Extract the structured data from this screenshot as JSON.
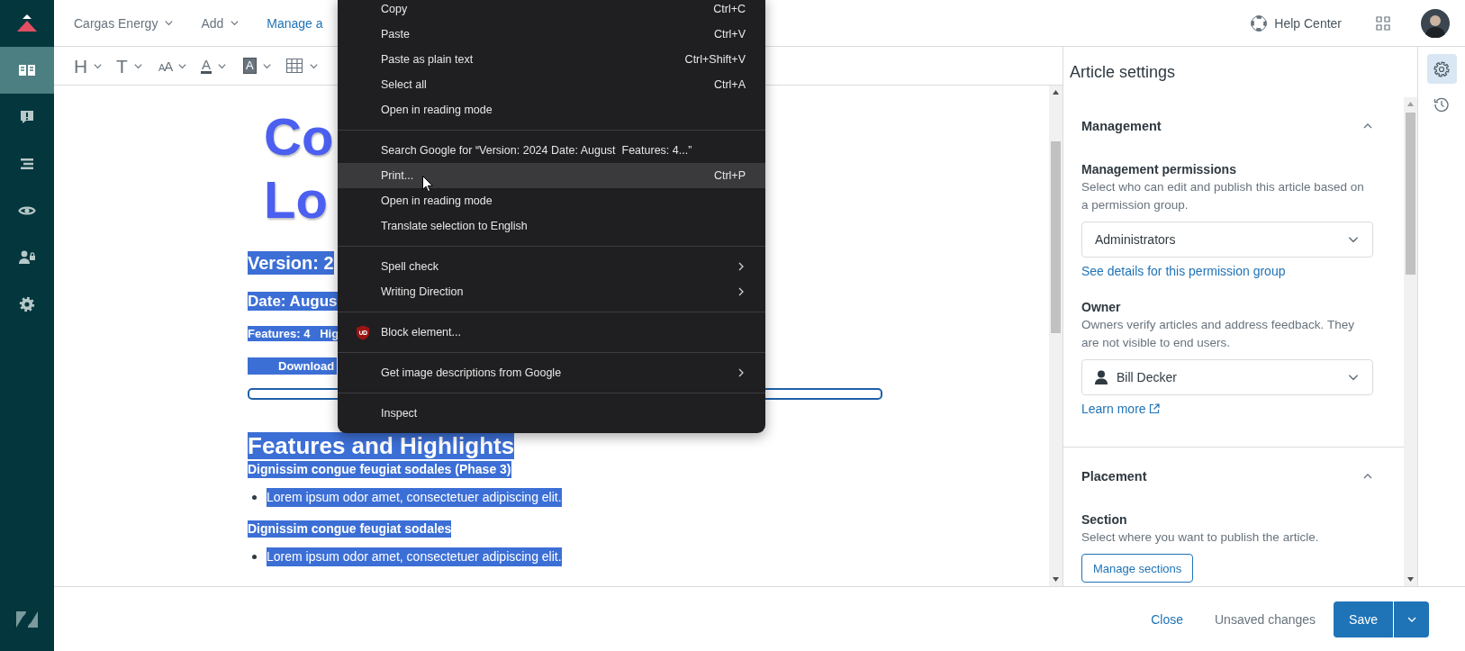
{
  "sidebar": {
    "items": [
      {
        "selected": true
      },
      {
        "selected": false
      },
      {
        "selected": false
      },
      {
        "selected": false
      },
      {
        "selected": false
      },
      {
        "selected": false
      }
    ]
  },
  "topbar": {
    "items": [
      {
        "kind": "menu",
        "label": "Cargas Energy"
      },
      {
        "kind": "menu",
        "label": "Add"
      },
      {
        "kind": "link",
        "label": "Manage a"
      }
    ],
    "help": {
      "label": "Help Center"
    }
  },
  "toolbar": {
    "tools": [
      {
        "kind": "glyph",
        "glyph": "H"
      },
      {
        "kind": "glyph",
        "glyph": "T"
      },
      {
        "kind": "size",
        "glyph": "AA"
      },
      {
        "kind": "color",
        "glyph": "A"
      },
      {
        "kind": "highlight",
        "glyph": "A"
      },
      {
        "kind": "table"
      }
    ]
  },
  "editor": {
    "title_lines": [
      "Co",
      "Lo"
    ],
    "blocks": [
      {
        "kind": "h2",
        "text": "Version: 2",
        "selected": true
      },
      {
        "kind": "h3",
        "text": "Date: Augus",
        "selected": true
      },
      {
        "kind": "meta",
        "text": "Features: 4   Hig",
        "selected": true
      },
      {
        "kind": "button",
        "text": "Download",
        "selected": true
      },
      {
        "kind": "rule"
      },
      {
        "kind": "h1",
        "text": "Features and Highlights",
        "selected": true
      },
      {
        "kind": "h4",
        "text": "Dignissim congue feugiat sodales (Phase 3)",
        "selected": true
      },
      {
        "kind": "bullet",
        "text": "Lorem ipsum odor amet, consectetuer adipiscing elit.",
        "selected": true
      },
      {
        "kind": "h4",
        "text": "Dignissim congue feugiat sodales",
        "selected": true
      },
      {
        "kind": "bullet",
        "text": "Lorem ipsum odor amet, consectetuer adipiscing elit.",
        "selected": true
      }
    ]
  },
  "settings": {
    "title": "Article settings",
    "sections": [
      {
        "title": "Management",
        "expanded": true,
        "fields": [
          {
            "kind": "select",
            "label": "Management permissions",
            "description": "Select who can edit and publish this article based on a permission group.",
            "value": "Administrators",
            "link": "See details for this permission group",
            "external": false
          },
          {
            "kind": "person-select",
            "label": "Owner",
            "description": "Owners verify articles and address feedback. They are not visible to end users.",
            "value": "Bill Decker",
            "link": "Learn more",
            "external": true
          }
        ]
      },
      {
        "title": "Placement",
        "expanded": true,
        "fields": [
          {
            "kind": "button",
            "label": "Section",
            "description": "Select where you want to publish the article.",
            "button": "Manage sections"
          }
        ]
      }
    ]
  },
  "side_tabs": [
    {
      "selected": true
    },
    {
      "selected": false
    }
  ],
  "footer": {
    "close": "Close",
    "status": "Unsaved changes",
    "save": "Save"
  },
  "context_menu": {
    "items": [
      {
        "kind": "item",
        "label": "Copy",
        "shortcut": "Ctrl+C",
        "submenu": false,
        "selected": false
      },
      {
        "kind": "item",
        "label": "Paste",
        "shortcut": "Ctrl+V",
        "submenu": false,
        "selected": false
      },
      {
        "kind": "item",
        "label": "Paste as plain text",
        "shortcut": "Ctrl+Shift+V",
        "submenu": false,
        "selected": false
      },
      {
        "kind": "item",
        "label": "Select all",
        "shortcut": "Ctrl+A",
        "submenu": false,
        "selected": false
      },
      {
        "kind": "item",
        "label": "Open in reading mode",
        "submenu": false,
        "selected": false
      },
      {
        "kind": "separator"
      },
      {
        "kind": "item",
        "label": "Search Google for “Version: 2024 Date: August  Features: 4...”",
        "submenu": false,
        "selected": false
      },
      {
        "kind": "item",
        "label": "Print...",
        "shortcut": "Ctrl+P",
        "submenu": false,
        "selected": true
      },
      {
        "kind": "item",
        "label": "Open in reading mode",
        "submenu": false,
        "selected": false
      },
      {
        "kind": "item",
        "label": "Translate selection to English",
        "submenu": false,
        "selected": false
      },
      {
        "kind": "separator"
      },
      {
        "kind": "item",
        "label": "Spell check",
        "submenu": true,
        "selected": false
      },
      {
        "kind": "item",
        "label": "Writing Direction",
        "submenu": true,
        "selected": false
      },
      {
        "kind": "separator"
      },
      {
        "kind": "extension-item",
        "label": "Block element...",
        "submenu": false,
        "selected": false
      },
      {
        "kind": "separator"
      },
      {
        "kind": "item",
        "label": "Get image descriptions from Google",
        "submenu": true,
        "selected": false
      },
      {
        "kind": "separator"
      },
      {
        "kind": "item",
        "label": "Inspect",
        "submenu": false,
        "selected": false
      }
    ]
  }
}
